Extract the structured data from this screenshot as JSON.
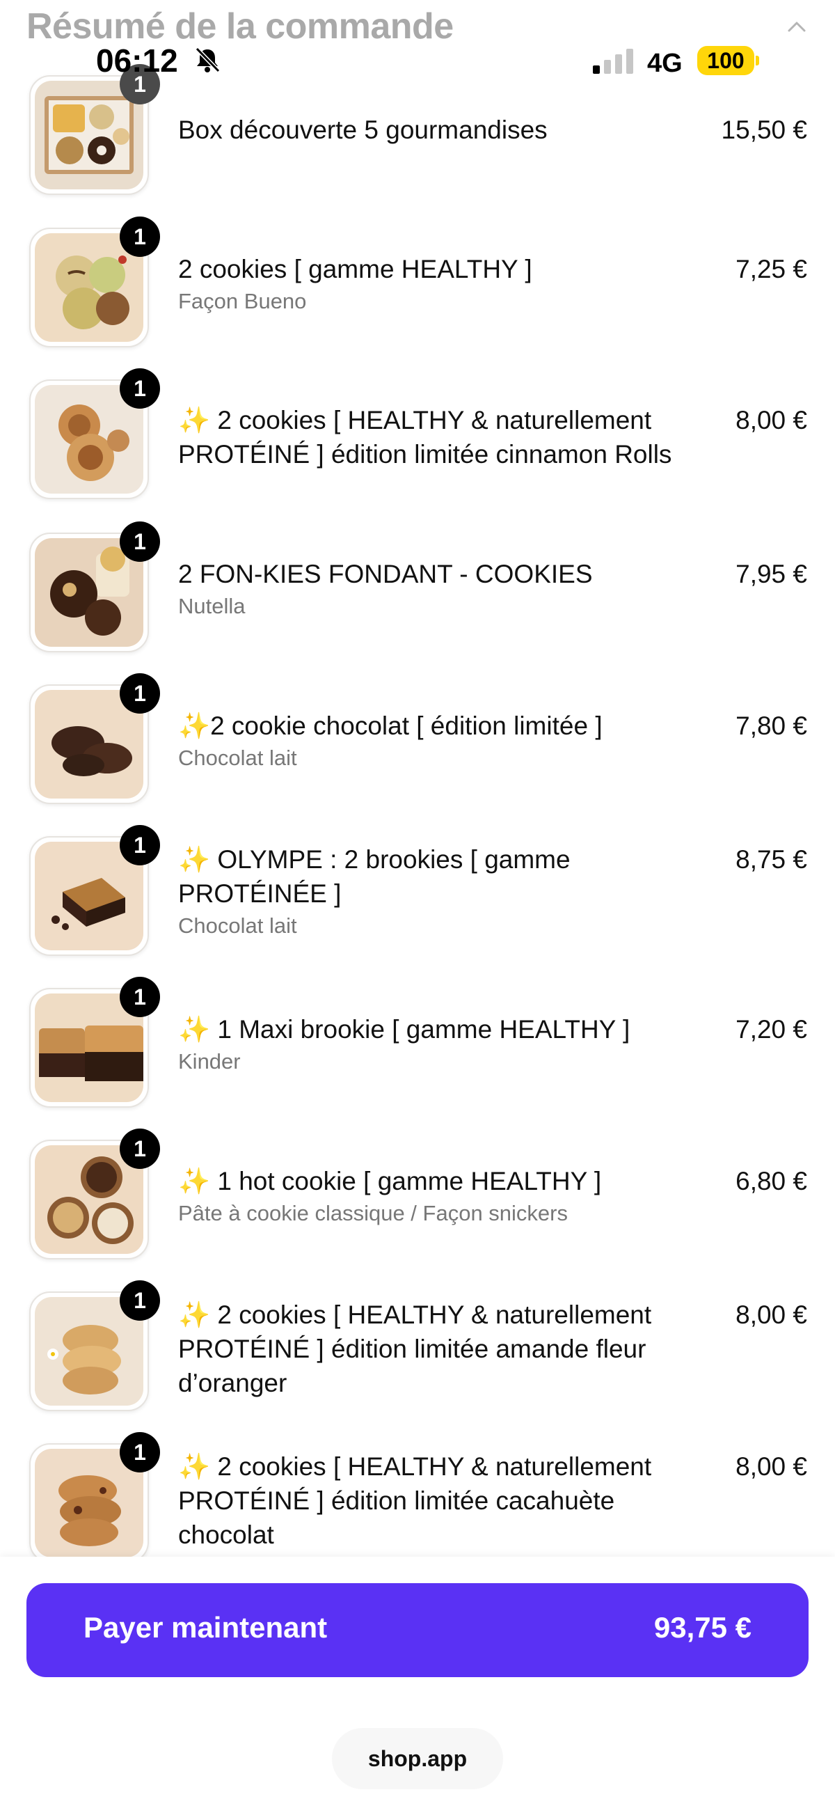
{
  "header": {
    "title": "Résumé de la commande"
  },
  "status_bar": {
    "time": "06:12",
    "network": "4G",
    "battery": "100"
  },
  "items": [
    {
      "qty": "1",
      "name": "Box découverte 5 gourmandises",
      "variant": "",
      "price": "15,50 €"
    },
    {
      "qty": "1",
      "name": "2 cookies [ gamme HEALTHY ]",
      "variant": "Façon Bueno",
      "price": "7,25 €"
    },
    {
      "qty": "1",
      "name": "✨ 2 cookies [ HEALTHY & naturellement PROTÉINÉ ] édition limitée cinnamon Rolls",
      "variant": "",
      "price": "8,00 €"
    },
    {
      "qty": "1",
      "name": "2 FON-KIES FONDANT - COOKIES",
      "variant": "Nutella",
      "price": "7,95 €"
    },
    {
      "qty": "1",
      "name": "✨2 cookie chocolat [ édition limitée ]",
      "variant": "Chocolat lait",
      "price": "7,80 €"
    },
    {
      "qty": "1",
      "name": "✨ OLYMPE : 2 brookies [ gamme PROTÉINÉE ]",
      "variant": "Chocolat lait",
      "price": "8,75 €"
    },
    {
      "qty": "1",
      "name": "✨ 1 Maxi brookie [ gamme HEALTHY ]",
      "variant": "Kinder",
      "price": "7,20 €"
    },
    {
      "qty": "1",
      "name": "✨ 1 hot cookie [ gamme HEALTHY ]",
      "variant": "Pâte à cookie classique / Façon snickers",
      "price": "6,80 €"
    },
    {
      "qty": "1",
      "name": "✨ 2 cookies [ HEALTHY & naturellement PROTÉINÉ ] édition limitée amande fleur d’oranger",
      "variant": "",
      "price": "8,00 €"
    },
    {
      "qty": "1",
      "name": "✨ 2 cookies [ HEALTHY & naturellement PROTÉINÉ ] édition limitée cacahuète chocolat",
      "variant": "",
      "price": "8,00 €"
    }
  ],
  "checkout": {
    "pay_label": "Payer maintenant",
    "total": "93,75 €",
    "accent_color": "#5a31f4"
  },
  "footer": {
    "shop_link": "shop.app"
  }
}
